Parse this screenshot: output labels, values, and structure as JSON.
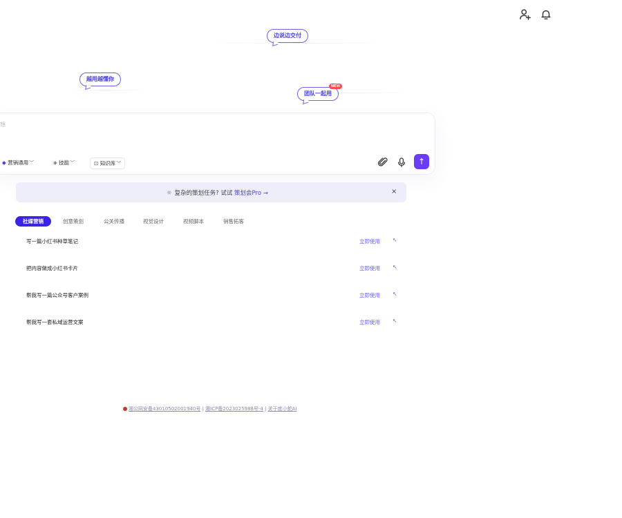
{
  "header": {
    "icons": [
      "user-add-icon",
      "notification-bell-icon"
    ]
  },
  "tags": {
    "left": "越用越懂你",
    "center": "边说边交付",
    "right": "团队一起用",
    "right_badge": "NEW"
  },
  "composer": {
    "placeholder": "想",
    "mode_label": "营销通用",
    "skills_label": "技能",
    "knowledge_label": "知识库",
    "icons": [
      "attachment-icon",
      "microphone-icon",
      "send-arrow-icon"
    ],
    "send_glyph": "↑"
  },
  "banner": {
    "prefix": "复杂的策划任务? 试试 ",
    "link": "策划会Pro →",
    "close": "×"
  },
  "tabs": [
    {
      "label": "社媒营销",
      "active": true
    },
    {
      "label": "创意策划",
      "active": false
    },
    {
      "label": "公关传播",
      "active": false
    },
    {
      "label": "视觉设计",
      "active": false
    },
    {
      "label": "视频脚本",
      "active": false
    },
    {
      "label": "销售拓客",
      "active": false
    }
  ],
  "tasks": [
    {
      "title": "写一篇小红书种草笔记",
      "action": "立即使用",
      "icon": "↖"
    },
    {
      "title": "把内容做成小红书卡片",
      "action": "立即使用",
      "icon": "↖"
    },
    {
      "title": "帮我写一篇公众号客户案例",
      "action": "立即使用",
      "icon": "↖"
    },
    {
      "title": "帮我写一套私域运营文案",
      "action": "立即使用",
      "icon": "↖"
    }
  ],
  "footer": {
    "beian_public": "湘公网安备43010502001940号",
    "separator": " | ",
    "icp": "湘ICP备2023025988号-4",
    "about": "关于度小蛇AI"
  },
  "colors": {
    "accent": "#3b22e8",
    "send_button": "#6a3cf5",
    "link": "#6b62e6",
    "banner_bg": "#eeeefb"
  }
}
